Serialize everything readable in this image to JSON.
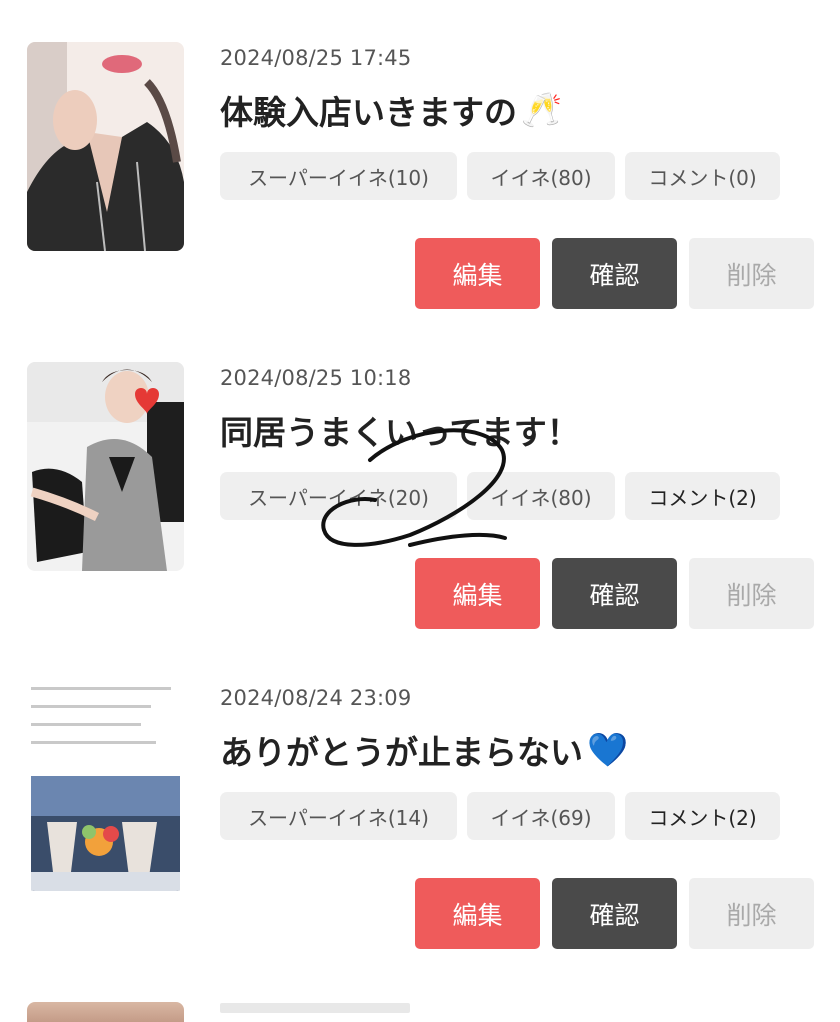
{
  "posts": [
    {
      "date": "2024/08/25 17:45",
      "title": "体験入店いきますの",
      "title_emoji": "🥂",
      "super_like": "スーパーイイネ(10)",
      "like": "イイネ(80)",
      "comment": "コメント(0)"
    },
    {
      "date": "2024/08/25 10:18",
      "title": "同居うまくいってます！",
      "title_emoji": "",
      "super_like": "スーパーイイネ(20)",
      "like": "イイネ(80)",
      "comment": "コメント(2)"
    },
    {
      "date": "2024/08/24 23:09",
      "title": "ありがとうが止まらない",
      "title_emoji": "💙",
      "super_like": "スーパーイイネ(14)",
      "like": "イイネ(69)",
      "comment": "コメント(2)"
    }
  ],
  "actions": {
    "edit": "編集",
    "confirm": "確認",
    "delete": "削除"
  },
  "colors": {
    "edit_button": "#ef5b5b",
    "confirm_button": "#4a4a4a",
    "delete_button": "#eeeeee",
    "chip_bg": "#efefef"
  }
}
